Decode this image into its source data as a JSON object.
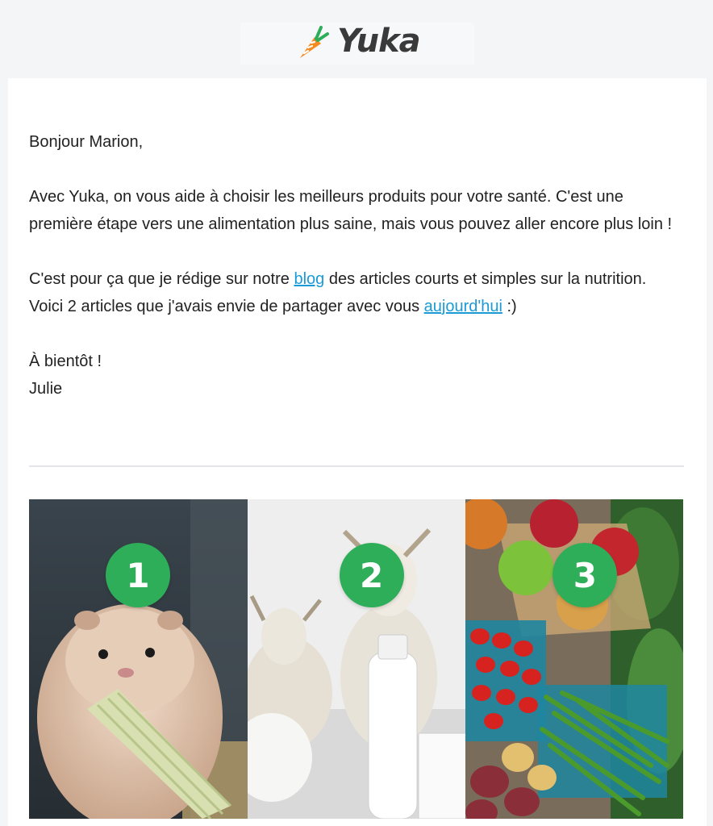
{
  "brand": {
    "name": "Yuka",
    "accent": "#2fae5a",
    "carrot_color": "#f58a1f"
  },
  "email": {
    "greeting": "Bonjour Marion,",
    "para1": "Avec Yuka, on vous aide à choisir les meilleurs produits pour votre santé. C'est une première étape vers une alimentation plus saine, mais vous pouvez aller encore plus loin !",
    "para2_before": "C'est pour ça que je rédige sur notre ",
    "blog_link": "blog",
    "para2_middle": " des articles courts et simples sur la nutrition. Voici 2 articles que j'avais envie de partager avec vous ",
    "today_link": "aujourd'hui",
    "para2_after": " :)",
    "signoff": "À bientôt !",
    "signature": "Julie",
    "link_color": "#1a9bd7"
  },
  "articles": [
    {
      "number": "1",
      "image": "hamster-eating-corn"
    },
    {
      "number": "2",
      "image": "goats-and-milk"
    },
    {
      "number": "3",
      "image": "fruits-and-vegetables"
    }
  ]
}
